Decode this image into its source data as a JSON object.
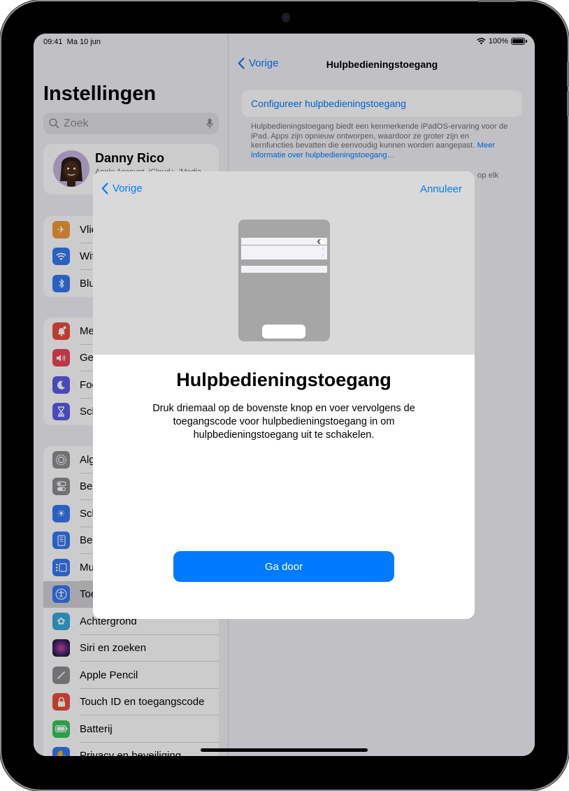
{
  "status_bar": {
    "time": "09:41",
    "date": "Ma 10 jun",
    "battery": "100%",
    "wifi_icon": "wifi-icon",
    "battery_icon": "battery-icon"
  },
  "sidebar": {
    "title": "Instellingen",
    "search_placeholder": "Zoek",
    "profile": {
      "name": "Danny Rico",
      "subtitle": "Apple Account, iCloud+, 'Media"
    },
    "groups": [
      {
        "items": [
          {
            "label": "Vliegtuigmodus",
            "icon": "airplane-icon",
            "color": "#f09a37"
          },
          {
            "label": "Wifi",
            "icon": "wifi-icon",
            "color": "#3478f6"
          },
          {
            "label": "Bluetooth",
            "icon": "bluetooth-icon",
            "color": "#3478f6"
          }
        ]
      },
      {
        "items": [
          {
            "label": "Meldingen",
            "icon": "notifications-icon",
            "color": "#eb4d3d"
          },
          {
            "label": "Geluiden",
            "icon": "sounds-icon",
            "color": "#eb445a"
          },
          {
            "label": "Focus",
            "icon": "moon-icon",
            "color": "#5e5ce6"
          },
          {
            "label": "Schermtijd",
            "icon": "hourglass-icon",
            "color": "#5e5ce6"
          }
        ]
      },
      {
        "items": [
          {
            "label": "Algemeen",
            "icon": "gear-icon",
            "color": "#8e8e93"
          },
          {
            "label": "Bedieningspaneel",
            "icon": "control-center-icon",
            "color": "#8e8e93"
          },
          {
            "label": "Scherm en helderheid",
            "icon": "brightness-icon",
            "color": "#3478f6"
          },
          {
            "label": "Beginscherm en appbibliotheek",
            "icon": "home-screen-icon",
            "color": "#3478f6"
          },
          {
            "label": "Multitasking en gebaren",
            "icon": "multitasking-icon",
            "color": "#3478f6"
          },
          {
            "label": "Toegankelijkheid",
            "icon": "accessibility-icon",
            "color": "#3478f6",
            "selected": true
          },
          {
            "label": "Achtergrond",
            "icon": "wallpaper-icon",
            "color": "#36aadc"
          },
          {
            "label": "Siri en zoeken",
            "icon": "siri-icon",
            "color": "#1c1c2e"
          },
          {
            "label": "Apple Pencil",
            "icon": "pencil-icon",
            "color": "#8e8e93"
          },
          {
            "label": "Touch ID en toegangscode",
            "icon": "lock-icon",
            "color": "#eb4d3d"
          },
          {
            "label": "Batterij",
            "icon": "battery-icon",
            "color": "#34c759"
          },
          {
            "label": "Privacy en beveiliging",
            "icon": "hand-icon",
            "color": "#3478f6"
          }
        ]
      }
    ]
  },
  "detail": {
    "back_label": "Vorige",
    "title": "Hulpbedieningstoegang",
    "config_label": "Configureer hulpbedieningstoegang",
    "footer": "Hulpbedieningstoegang biedt een kenmerkende iPadOS-ervaring voor de iPad. Apps zijn opnieuw ontworpen, waardoor ze groter zijn en kernfuncties bevatten die eenvoudig kunnen worden aangepast.",
    "footer_link": "Meer informatie over hulpbedieningstoegang…",
    "partial_text": "op elk"
  },
  "sheet": {
    "back_label": "Vorige",
    "cancel_label": "Annuleer",
    "title": "Hulpbedieningstoegang",
    "body": "Druk driemaal op de bovenste knop en voer vervolgens de toegangscode voor hulpbedieningstoegang in om hulpbedieningstoegang uit te schakelen.",
    "continue_label": "Ga door"
  },
  "colors": {
    "accent": "#007aff",
    "background": "#f2f2f7"
  }
}
